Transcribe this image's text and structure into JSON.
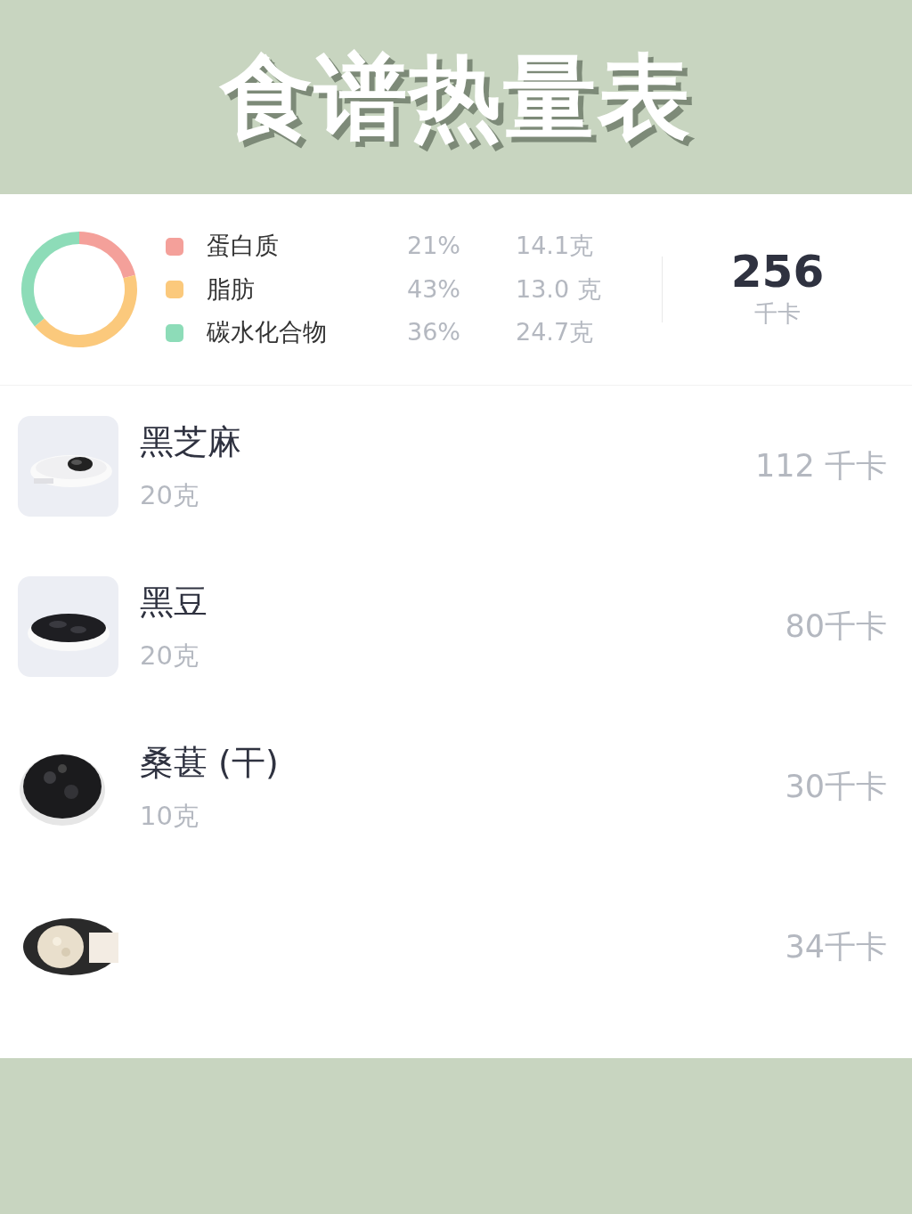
{
  "title": "食谱热量表",
  "summary": {
    "chart_data": {
      "type": "donut",
      "values": [
        21,
        43,
        36
      ]
    },
    "macros": [
      {
        "name": "蛋白质",
        "percent": "21%",
        "amount": "14.1克",
        "color": "#f4a09a"
      },
      {
        "name": "脂肪",
        "percent": "43%",
        "amount": "13.0 克",
        "color": "#fbc97c"
      },
      {
        "name": "碳水化合物",
        "percent": "36%",
        "amount": "24.7克",
        "color": "#8ddcb8"
      }
    ],
    "total": "256",
    "unit": "千卡"
  },
  "foods": [
    {
      "name": "黑芝麻",
      "amount": "20克",
      "calories": "112 千卡",
      "kind": "picture"
    },
    {
      "name": "黑豆",
      "amount": "20克",
      "calories": "80千卡",
      "kind": "picture"
    },
    {
      "name": "桑葚 (干)",
      "amount": "10克",
      "calories": "30千卡",
      "kind": "picture"
    },
    {
      "calories": "34千卡",
      "kind": "picture"
    }
  ]
}
